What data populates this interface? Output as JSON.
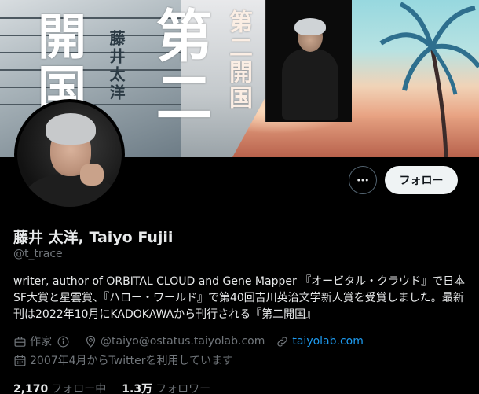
{
  "banner": {
    "cover_title_kai": "開国",
    "cover_author": "藤井太洋",
    "cover_title_dai": "第二",
    "cover_subtitle": "第二開国"
  },
  "actions": {
    "more_icon": "more-horizontal-icon",
    "follow_label": "フォロー"
  },
  "profile": {
    "display_name": "藤井 太洋, Taiyo Fujii",
    "handle": "@t_trace",
    "bio": "writer, author of ORBITAL CLOUD and Gene Mapper 『オービタル・クラウド』で日本SF大賞と星雲賞、『ハロー・ワールド』で第40回吉川英治文学新人賞を受賞しました。最新刊は2022年10月にKADOKAWAから刊行される『第二開国』",
    "category": "作家",
    "category_icon": "briefcase-icon",
    "info_icon": "info-icon",
    "location": "@taiyo@ostatus.taiyolab.com",
    "location_icon": "location-pin-icon",
    "website": "taiyolab.com",
    "website_icon": "link-icon",
    "joined": "2007年4月からTwitterを利用しています",
    "joined_icon": "calendar-icon"
  },
  "stats": {
    "following_count": "2,170",
    "following_label": "フォロー中",
    "followers_count": "1.3万",
    "followers_label": "フォロワー"
  },
  "colors": {
    "background": "#000000",
    "text_primary": "#e7e9ea",
    "text_secondary": "#71767b",
    "link": "#1d9bf0",
    "follow_button_bg": "#eff3f4"
  }
}
